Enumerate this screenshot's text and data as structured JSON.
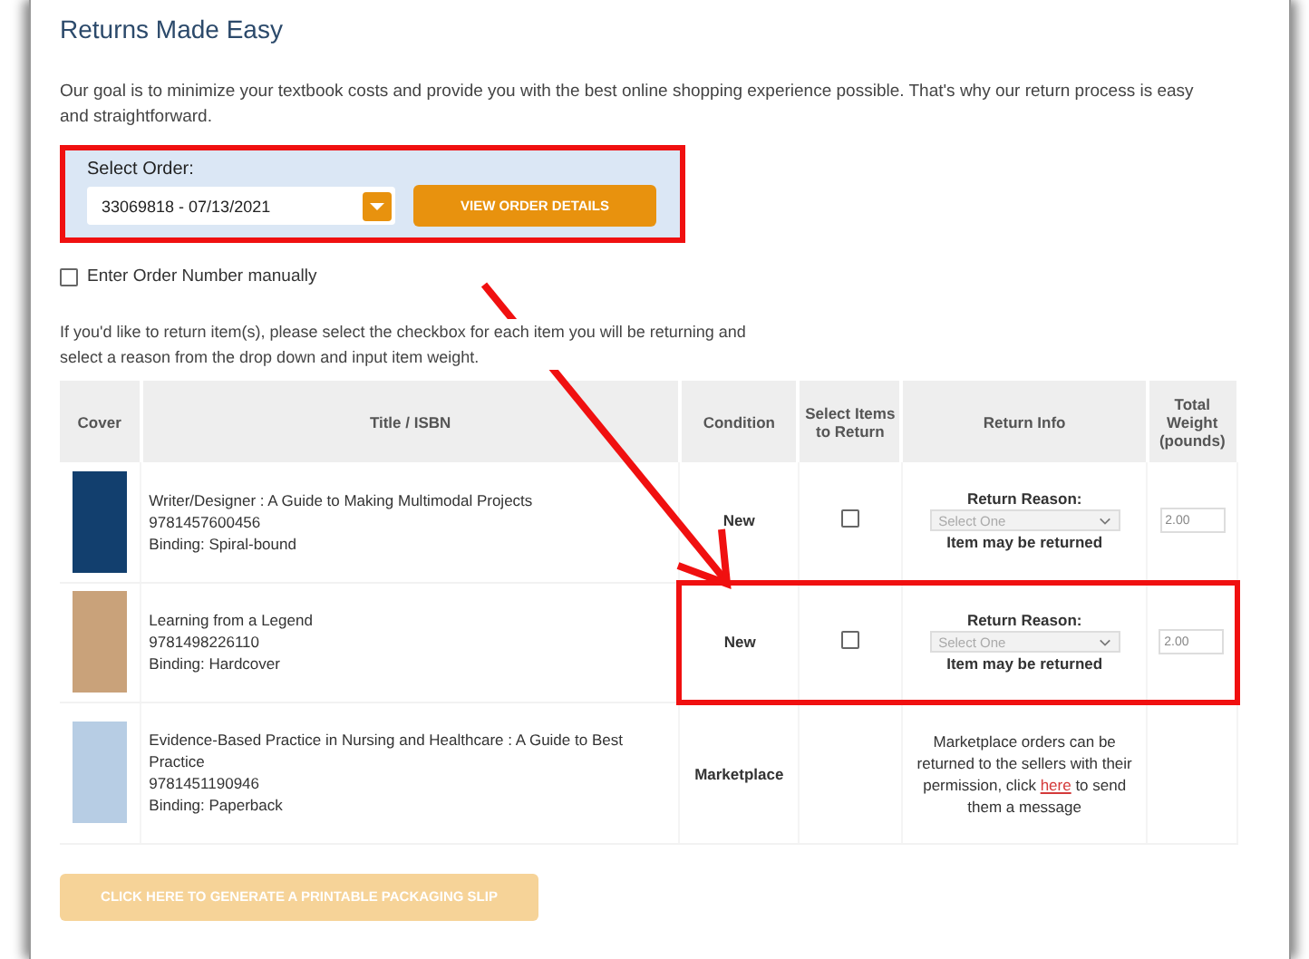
{
  "heading": "Returns Made Easy",
  "intro": "Our goal is to minimize your textbook costs and provide you with the best online shopping experience possible. That's why our return process is easy and straightforward.",
  "order_panel": {
    "label": "Select Order:",
    "value": "33069818 - 07/13/2021",
    "button": "VIEW ORDER DETAILS",
    "highlighted": true
  },
  "manual_entry": {
    "label": "Enter Order Number manually",
    "checked": false
  },
  "instructions": "If you'd like to return item(s), please select the checkbox for each item you will be returning and select a reason from the drop down and input item weight.",
  "table": {
    "columns": [
      "Cover",
      "Title / ISBN",
      "Condition",
      "Select Items to Return",
      "Return Info",
      "Total Weight (pounds)"
    ],
    "rows": [
      {
        "kind": "returnable",
        "title": "Writer/Designer : A Guide to Making Multimodal Projects",
        "isbn": "9781457600456",
        "binding": "Binding: Spiral-bound",
        "condition": "New",
        "checked": false,
        "reason_label": "Return Reason:",
        "reason_value": "Select One",
        "note": "Item may be returned",
        "weight": "2.00",
        "highlighted": false
      },
      {
        "kind": "returnable",
        "title": "Learning from a Legend",
        "isbn": "9781498226110",
        "binding": "Binding: Hardcover",
        "condition": "New",
        "checked": false,
        "reason_label": "Return Reason:",
        "reason_value": "Select One",
        "note": "Item may be returned",
        "weight": "2.00",
        "highlighted": true
      },
      {
        "kind": "marketplace",
        "title": "Evidence-Based Practice in Nursing and Healthcare : A Guide to Best Practice",
        "isbn": "9781451190946",
        "binding": "Binding: Paperback",
        "condition": "Marketplace",
        "message_before": "Marketplace orders can be returned to the sellers with their permission, click ",
        "link": "here",
        "message_after": " to send them a message",
        "highlighted": false
      }
    ]
  },
  "slip_button": {
    "label": "CLICK HERE TO GENERATE A PRINTABLE PACKAGING SLIP",
    "disabled": true
  }
}
